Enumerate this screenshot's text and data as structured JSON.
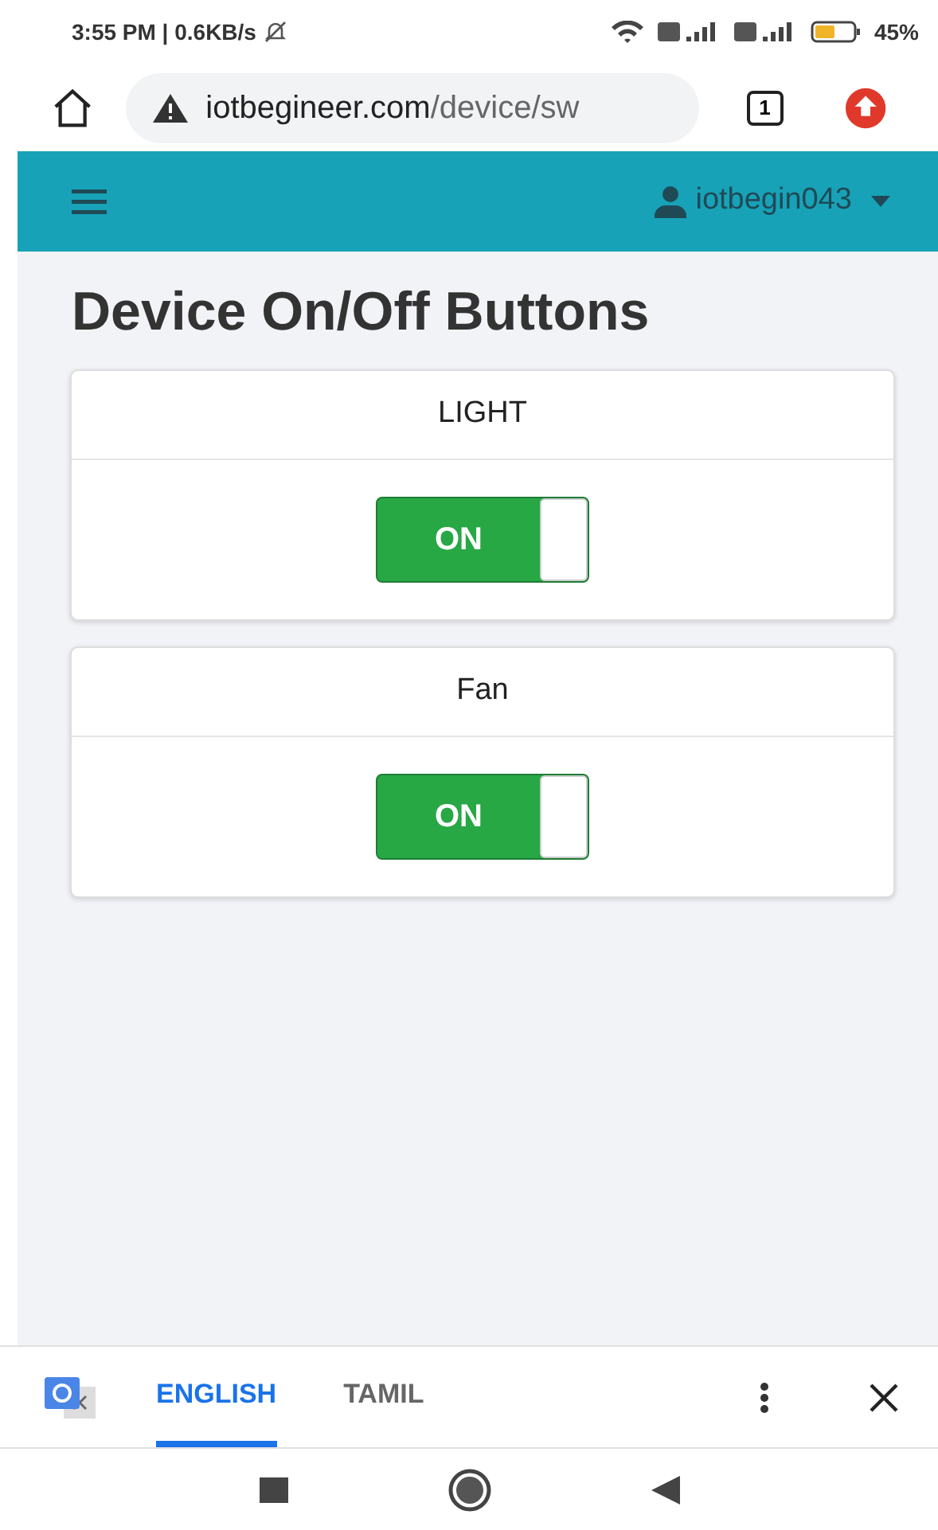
{
  "status_bar": {
    "time": "3:55 PM | 0.6KB/s",
    "battery": "45%"
  },
  "browser": {
    "url_domain": "iotbegineer.com",
    "url_path": "/device/sw",
    "tab_count": "1"
  },
  "navbar": {
    "user": "iotbegin043"
  },
  "title": "Device On/Off Buttons",
  "devices": [
    {
      "name": "LIGHT",
      "switch_label": "ON",
      "on": true
    },
    {
      "name": "Fan",
      "switch_label": "ON",
      "on": true
    }
  ],
  "translate_bar": {
    "tabs": [
      {
        "label": "ENGLISH",
        "selected": true
      },
      {
        "label": "TAMIL",
        "selected": false
      }
    ]
  }
}
